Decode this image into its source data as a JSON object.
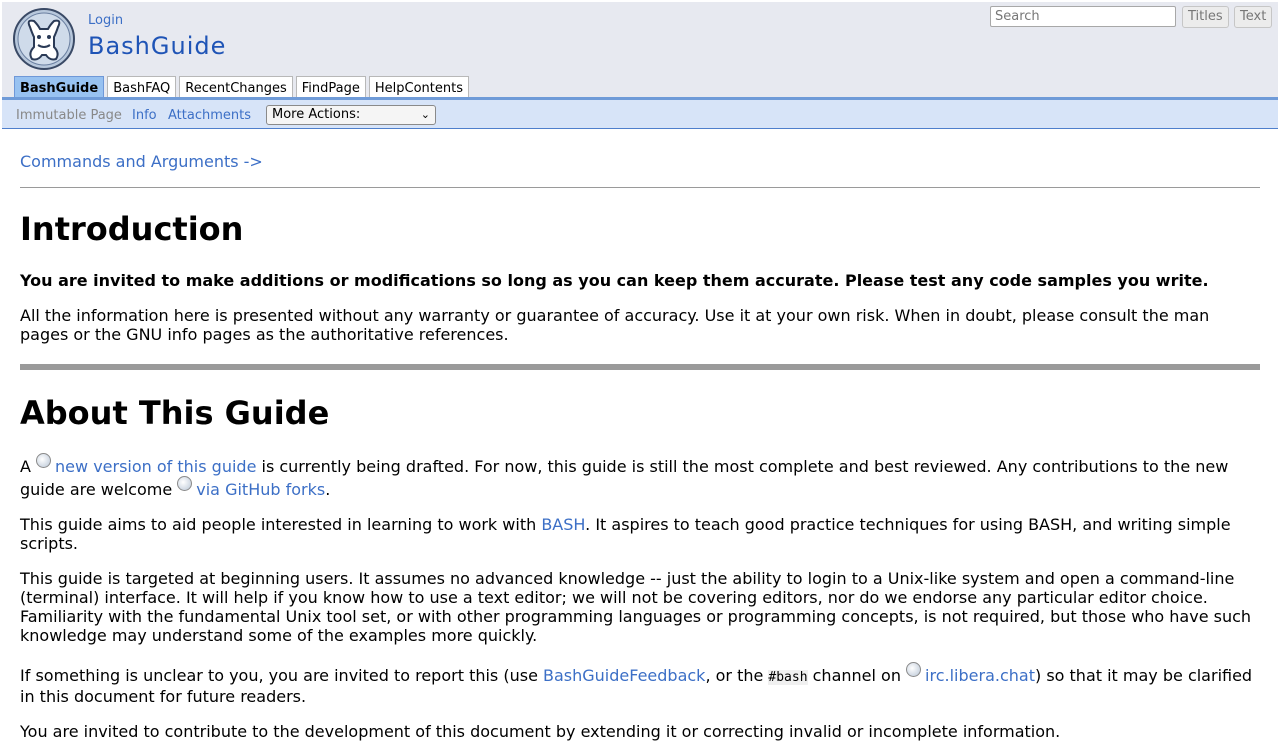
{
  "header": {
    "login_label": "Login",
    "site_title": "BashGuide",
    "search_placeholder": "Search",
    "titles_button": "Titles",
    "text_button": "Text",
    "tabs": [
      {
        "label": "BashGuide",
        "active": true
      },
      {
        "label": "BashFAQ",
        "active": false
      },
      {
        "label": "RecentChanges",
        "active": false
      },
      {
        "label": "FindPage",
        "active": false
      },
      {
        "label": "HelpContents",
        "active": false
      }
    ]
  },
  "actions": {
    "immutable": "Immutable Page",
    "info": "Info",
    "attachments": "Attachments",
    "more_actions": "More Actions:"
  },
  "content": {
    "next_link": "Commands and Arguments ->",
    "intro_heading": "Introduction",
    "intro_bold": "You are invited to make additions or modifications so long as you can keep them accurate. Please test any code samples you write.",
    "intro_text": "All the information here is presented without any warranty or guarantee of accuracy. Use it at your own risk. When in doubt, please consult the man pages or the GNU info pages as the authoritative references.",
    "about_heading": "About This Guide",
    "p1": {
      "a": "A ",
      "link1": "new version of this guide",
      "b": " is currently being drafted. For now, this guide is still the most complete and best reviewed. Any contributions to the new guide are welcome ",
      "link2": "via GitHub forks",
      "c": "."
    },
    "p2": {
      "a": "This guide aims to aid people interested in learning to work with ",
      "link": "BASH",
      "b": ". It aspires to teach good practice techniques for using BASH, and writing simple scripts."
    },
    "p3": "This guide is targeted at beginning users. It assumes no advanced knowledge -- just the ability to login to a Unix-like system and open a command-line (terminal) interface. It will help if you know how to use a text editor; we will not be covering editors, nor do we endorse any particular editor choice. Familiarity with the fundamental Unix tool set, or with other programming languages or programming concepts, is not required, but those who have such knowledge may understand some of the examples more quickly.",
    "p4": {
      "a": "If something is unclear to you, you are invited to report this (use ",
      "link1": "BashGuideFeedback",
      "b": ", or the ",
      "code": "#bash",
      "c": " channel on ",
      "link2": "irc.libera.chat",
      "d": ") so that it may be clarified in this document for future readers."
    },
    "p5": "You are invited to contribute to the development of this document by extending it or correcting invalid or incomplete information."
  }
}
